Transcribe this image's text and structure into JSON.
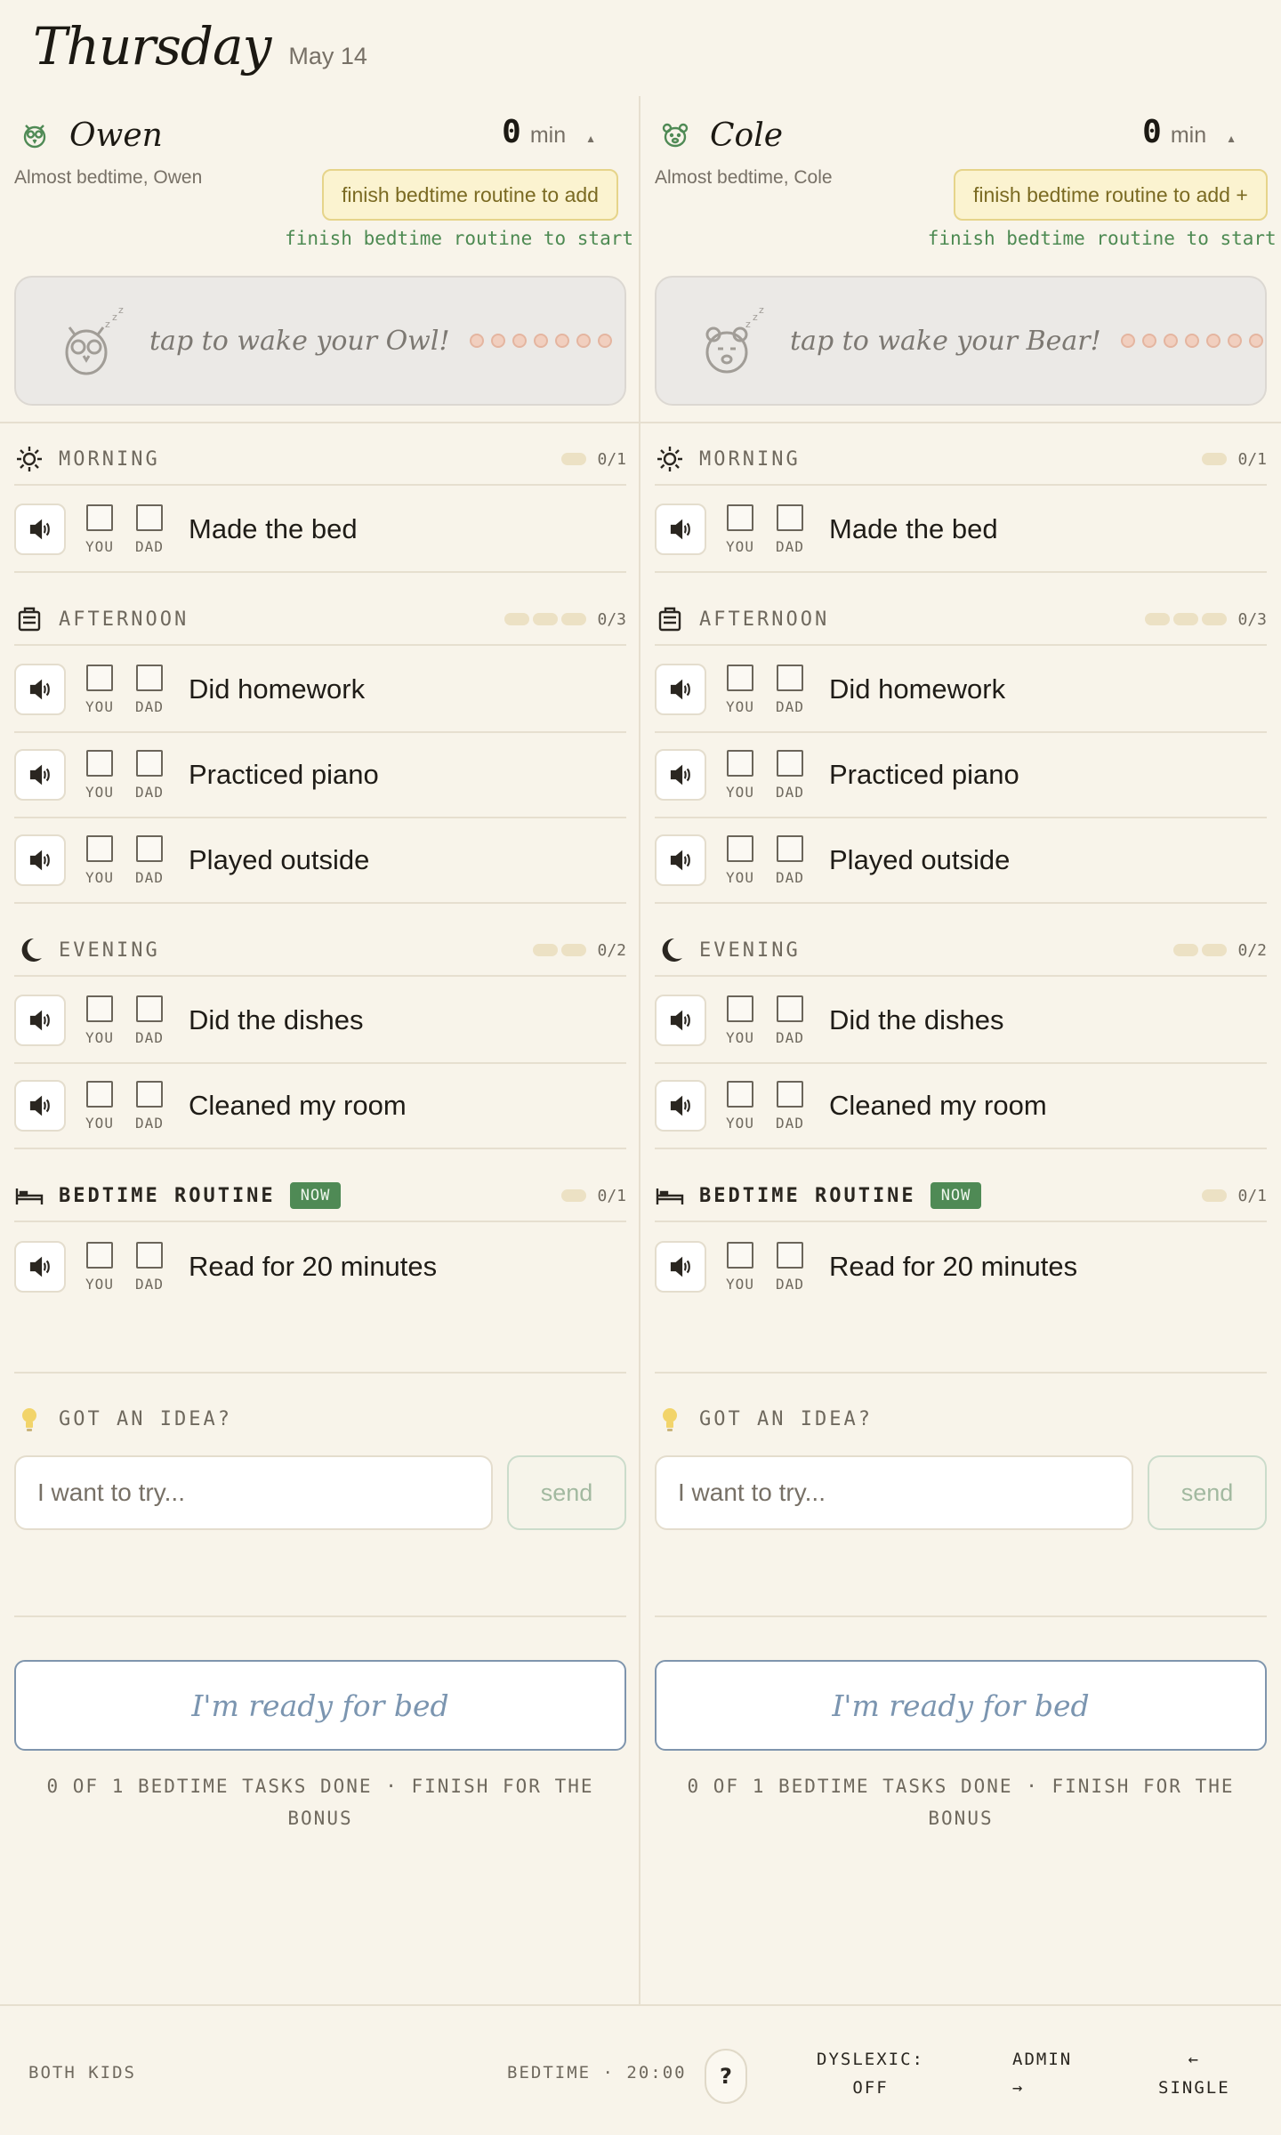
{
  "header": {
    "day": "Thursday",
    "date": "May 14"
  },
  "kids": [
    {
      "name": "Owen",
      "minutes": "0",
      "minutes_unit": "min",
      "greeting": "Almost bedtime, Owen",
      "add_notice": "finish bedtime routine to add",
      "start_notice": "finish bedtime routine to start",
      "wake_text": "tap to wake your Owl!",
      "avatar_icon": "owl-icon",
      "sections": {
        "morning": {
          "title": "MORNING",
          "count": "0/1",
          "tasks": [
            "Made the bed"
          ]
        },
        "afternoon": {
          "title": "AFTERNOON",
          "count": "0/3",
          "tasks": [
            "Did homework",
            "Practiced piano",
            "Played outside"
          ]
        },
        "evening": {
          "title": "EVENING",
          "count": "0/2",
          "tasks": [
            "Did the dishes",
            "Cleaned my room"
          ]
        },
        "bedtime": {
          "title": "BEDTIME ROUTINE",
          "badge": "NOW",
          "count": "0/1",
          "tasks": [
            "Read for 20 minutes"
          ]
        }
      },
      "idea": {
        "title": "GOT AN IDEA?",
        "placeholder": "I want to try...",
        "send": "send"
      },
      "ready": {
        "button": "I'm ready for bed",
        "note": "0 OF 1 BEDTIME TASKS DONE · FINISH FOR THE BONUS"
      }
    },
    {
      "name": "Cole",
      "minutes": "0",
      "minutes_unit": "min",
      "greeting": "Almost bedtime, Cole",
      "add_notice": "finish bedtime routine to add +",
      "start_notice": "finish bedtime routine to start e",
      "wake_text": "tap to wake your Bear!",
      "avatar_icon": "bear-icon",
      "sections": {
        "morning": {
          "title": "MORNING",
          "count": "0/1",
          "tasks": [
            "Made the bed"
          ]
        },
        "afternoon": {
          "title": "AFTERNOON",
          "count": "0/3",
          "tasks": [
            "Did homework",
            "Practiced piano",
            "Played outside"
          ]
        },
        "evening": {
          "title": "EVENING",
          "count": "0/2",
          "tasks": [
            "Did the dishes",
            "Cleaned my room"
          ]
        },
        "bedtime": {
          "title": "BEDTIME ROUTINE",
          "badge": "NOW",
          "count": "0/1",
          "tasks": [
            "Read for 20 minutes"
          ]
        }
      },
      "idea": {
        "title": "GOT AN IDEA?",
        "placeholder": "I want to try...",
        "send": "send"
      },
      "ready": {
        "button": "I'm ready for bed",
        "note": "0 OF 1 BEDTIME TASKS DONE · FINISH FOR THE BONUS"
      }
    }
  ],
  "checkbox_labels": {
    "you": "YOU",
    "dad": "DAD"
  },
  "footer": {
    "mode": "BOTH KIDS",
    "bedtime": "BEDTIME · 20:00",
    "help": "?",
    "dyslexic_label": "DYSLEXIC:",
    "dyslexic_value": "OFF",
    "admin_label": "ADMIN",
    "admin_arrow": "→",
    "single_arrow": "←",
    "single_label": "SINGLE"
  },
  "colors": {
    "background": "#f8f4ea",
    "accent_green": "#4f8a55",
    "ready_blue": "#7b95b0",
    "pill_yellow": "#fbf3d0"
  }
}
